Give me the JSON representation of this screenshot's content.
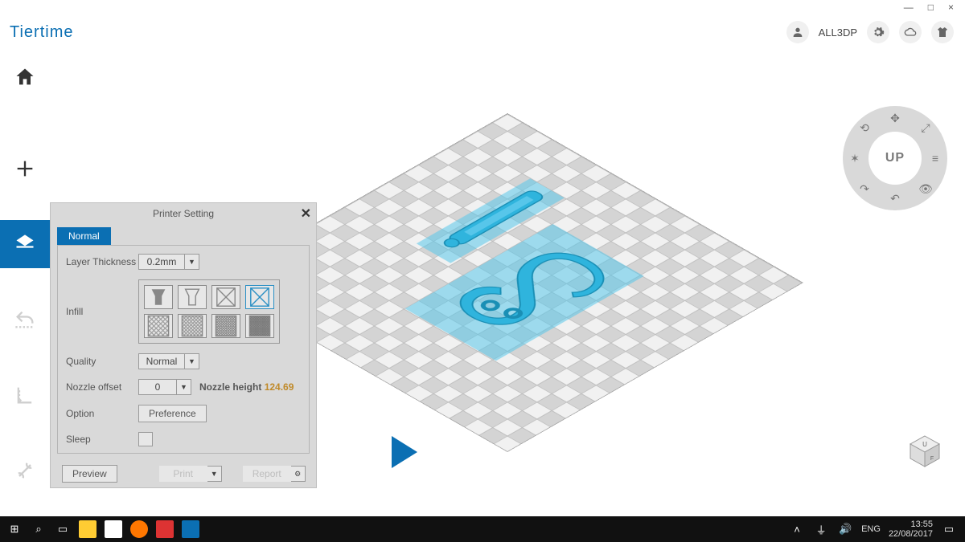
{
  "window_controls": {
    "min": "—",
    "max": "□",
    "close": "×"
  },
  "brand": "Tiertime",
  "header": {
    "user_label": "ALL3DP"
  },
  "navwheel": {
    "hub": "UP"
  },
  "sidebar": {
    "items": [
      {
        "id": "home"
      },
      {
        "id": "add"
      },
      {
        "id": "print",
        "active": true
      },
      {
        "id": "undo"
      },
      {
        "id": "measure"
      },
      {
        "id": "tools"
      }
    ]
  },
  "panel": {
    "title": "Printer Setting",
    "close": "✕",
    "tab": "Normal",
    "rows": {
      "layer_thickness_label": "Layer Thickness",
      "layer_thickness_value": "0.2mm",
      "infill_label": "Infill",
      "quality_label": "Quality",
      "quality_value": "Normal",
      "nozzle_offset_label": "Nozzle offset",
      "nozzle_offset_value": "0",
      "nozzle_height_label": "Nozzle height",
      "nozzle_height_value": "124.69",
      "option_label": "Option",
      "option_button": "Preference",
      "sleep_label": "Sleep"
    },
    "actions": {
      "preview": "Preview",
      "print": "Print",
      "report": "Report"
    }
  },
  "taskbar": {
    "lang": "ENG",
    "time": "13:55",
    "date": "22/08/2017"
  }
}
